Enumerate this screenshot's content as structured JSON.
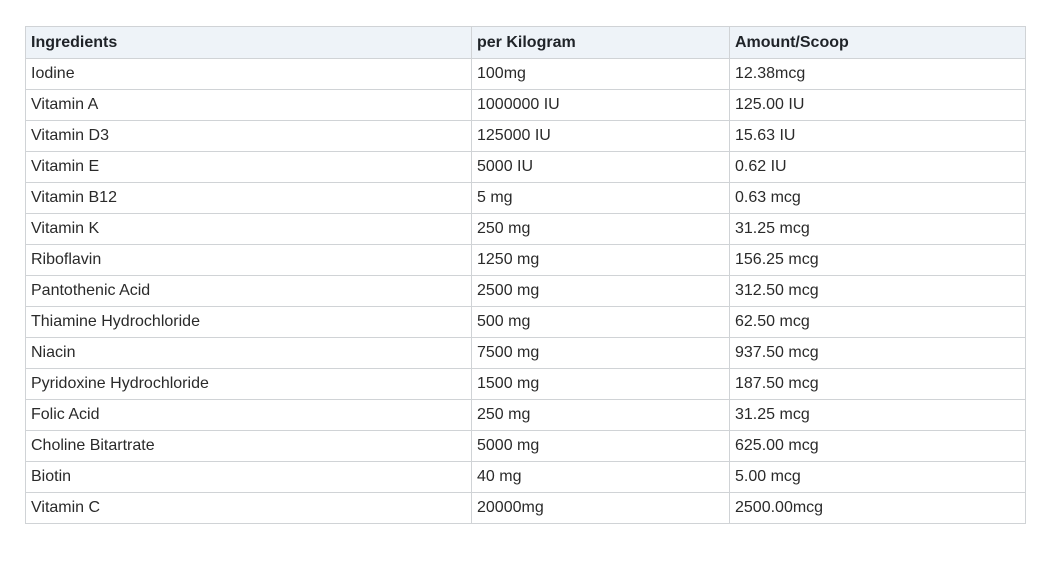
{
  "table": {
    "headers": [
      "Ingredients",
      "per Kilogram",
      "Amount/Scoop"
    ],
    "rows": [
      [
        "Iodine",
        "100mg",
        "12.38mcg"
      ],
      [
        "Vitamin A",
        "1000000 IU",
        "125.00 IU"
      ],
      [
        "Vitamin D3",
        "125000 IU",
        "15.63 IU"
      ],
      [
        "Vitamin E",
        "5000 IU",
        "0.62 IU"
      ],
      [
        "Vitamin B12",
        "5 mg",
        "0.63 mcg"
      ],
      [
        "Vitamin K",
        "250 mg",
        "31.25 mcg"
      ],
      [
        "Riboflavin",
        "1250 mg",
        "156.25 mcg"
      ],
      [
        "Pantothenic Acid",
        "2500 mg",
        "312.50 mcg"
      ],
      [
        "Thiamine Hydrochloride",
        "500 mg",
        "62.50 mcg"
      ],
      [
        "Niacin",
        "7500 mg",
        "937.50 mcg"
      ],
      [
        "Pyridoxine Hydrochloride",
        "1500 mg",
        "187.50 mcg"
      ],
      [
        "Folic Acid",
        "250 mg",
        "31.25 mcg"
      ],
      [
        "Choline Bitartrate",
        "5000 mg",
        "625.00 mcg"
      ],
      [
        "Biotin",
        "40 mg",
        "5.00 mcg"
      ],
      [
        "Vitamin C",
        "20000mg",
        "2500.00mcg"
      ]
    ]
  },
  "colors": {
    "header_background": "#eef3f8",
    "border": "#d0d3d6",
    "text": "#2a2a2a"
  }
}
